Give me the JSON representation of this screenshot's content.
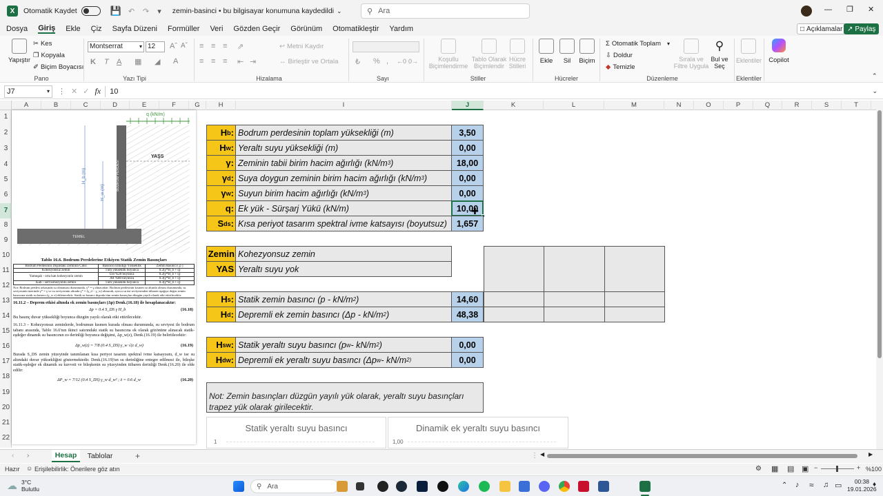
{
  "titlebar": {
    "autosave_label": "Otomatik Kaydet",
    "file_title": "zemin-basinci • bu bilgisayar konumuna kaydedildi",
    "search_placeholder": "Ara"
  },
  "menu": {
    "items": [
      "Dosya",
      "Giriş",
      "Ekle",
      "Çiz",
      "Sayfa Düzeni",
      "Formüller",
      "Veri",
      "Gözden Geçir",
      "Görünüm",
      "Otomatikleştir",
      "Yardım"
    ],
    "active": "Giriş",
    "comments": "Açıklamalar",
    "share": "Paylaş"
  },
  "ribbon": {
    "clipboard": {
      "paste": "Yapıştır",
      "cut": "Kes",
      "copy": "Kopyala",
      "format_painter": "Biçim Boyacısı",
      "group": "Pano"
    },
    "font": {
      "name": "Montserrat",
      "size": "12",
      "group": "Yazı Tipi"
    },
    "alignment": {
      "wrap": "Metni Kaydır",
      "merge": "Birleştir ve Ortala",
      "group": "Hizalama"
    },
    "number": {
      "group": "Sayı"
    },
    "styles": {
      "conditional": "Koşullu Biçimlendirme",
      "table": "Tablo Olarak Biçimlendir",
      "cell": "Hücre Stilleri",
      "group": "Stiller"
    },
    "cells": {
      "insert": "Ekle",
      "delete": "Sil",
      "format": "Biçim",
      "group": "Hücreler"
    },
    "editing": {
      "autosum": "Otomatik Toplam",
      "fill": "Doldur",
      "clear": "Temizle",
      "sort": "Sırala ve Filtre Uygula",
      "find": "Bul ve Seç",
      "group": "Düzenleme"
    },
    "addins": {
      "label": "Eklentiler",
      "group": "Eklentiler"
    },
    "copilot": {
      "label": "Copilot"
    }
  },
  "formula_bar": {
    "cell": "J7",
    "fx": "fx",
    "value": "10"
  },
  "columns": [
    "A",
    "B",
    "C",
    "D",
    "E",
    "F",
    "G",
    "H",
    "I",
    "J",
    "K",
    "L",
    "M",
    "N",
    "O",
    "P",
    "Q",
    "R",
    "S",
    "T"
  ],
  "selected_column": "J",
  "rows": [
    "1",
    "2",
    "3",
    "4",
    "5",
    "6",
    "7",
    "8",
    "9",
    "10",
    "11",
    "12",
    "13",
    "14",
    "15",
    "16",
    "17",
    "18",
    "19",
    "20",
    "21",
    "22"
  ],
  "selected_row": "7",
  "inputs": [
    {
      "sym": "H",
      "sub": "b",
      "desc": "Bodrum perdesinin toplam yüksekliği (m)",
      "sup": "",
      "tail": "",
      "value": "3,50"
    },
    {
      "sym": "H",
      "sub": "w",
      "desc": "Yeraltı suyu yüksekliği (m)",
      "sup": "",
      "tail": "",
      "value": "0,00"
    },
    {
      "sym": "γ",
      "sub": "",
      "desc": "Zeminin tabii birim hacim ağırlığı (kN/m",
      "sup": "3",
      "tail": " )",
      "value": "18,00"
    },
    {
      "sym": "γ",
      "sub": "d",
      "desc": "Suya doygun zeminin birim hacim ağırlığı (kN/m",
      "sup": "3",
      "tail": " )",
      "value": "0,00"
    },
    {
      "sym": "γ",
      "sub": "w",
      "desc": "Suyun birim hacim ağırlığı (kN/m",
      "sup": "3",
      "tail": " )",
      "value": "0,00"
    },
    {
      "sym": "q",
      "sub": "",
      "desc": "Ek yük - Sürşarj Yükü (kN/m)",
      "sup": "",
      "tail": "",
      "value": "10,00"
    },
    {
      "sym": "S",
      "sub": "ds",
      "desc": "Kısa periyot tasarım spektral ivme katsayısı (boyutsuz)",
      "sup": "",
      "tail": "",
      "value": "1,657"
    }
  ],
  "soil": [
    {
      "label": "Zemin",
      "value": "Kohezyonsuz zemin"
    },
    {
      "label": "YAS",
      "value": "Yeraltı suyu yok"
    }
  ],
  "results": [
    {
      "sym": "H",
      "sub": "s",
      "desc": "Statik zemin basıncı (p - kN/m",
      "sup": "2",
      "tail": " )",
      "value": "14,60"
    },
    {
      "sym": "H",
      "sub": "d",
      "desc": "Depremli ek zemin basıncı (Δp - kN/m",
      "sup": "2",
      "tail": " )",
      "value": "48,38"
    },
    {
      "sym": "H",
      "sub": "sw",
      "desc": "Statik yeraltı suyu basıncı (p",
      "descsub": "w",
      "desc2": " - kN/m",
      "sup": "2",
      "tail": " )",
      "value": "0,00"
    },
    {
      "sym": "H",
      "sub": "dw",
      "desc": "Depremli ek yeraltı suyu basıncı (Δp",
      "descsub": "w",
      "desc2": " - kN/m",
      "sup": "2)",
      "tail": "",
      "value": "0,00"
    }
  ],
  "note": {
    "line1": "Not: Zemin basınçları düzgün yayılı yük olarak, yeraltı suyu basınçları",
    "line2": "trapez yük olarak girilecektir."
  },
  "charts": [
    {
      "title": "Statik yeraltı suyu basıncı",
      "tick": "1"
    },
    {
      "title": "Dinamik ek yeraltı suyu basıncı",
      "tick": "1,00"
    }
  ],
  "figure": {
    "q_label": "q (kN/m)",
    "yas": "YAŞS",
    "hb": "H_b (m)",
    "hw": "H_w (m)",
    "wall": "BODRUM PERDESİ",
    "base": "TEMEL"
  },
  "doc": {
    "table_title": "Tablo 16.6. Bodrum Perdelerine Etkiyen Statik Zemin Basınçları",
    "col1": "Bodrum Perdesinin Dışındaki Zeminin Cinsi",
    "col2": "Basıncın Etkidiği Yükseklik",
    "col3": "Zemin Basıncı ( p )",
    "r1a": "Kohezyonsuz zemin",
    "r1b": "Tüm yükseklik boyunca",
    "r1c": "0.2(γ*H_b + q)",
    "r2a": "Yumuşak - orta katı kohezyonlu zemin",
    "r2b": "Üst %20 boyunca",
    "r2c": "0.2(γ*H_b + q)",
    "r2b2": "Alt %80 boyunca",
    "r2c2": "0.3(γ*H_b + q)",
    "r3a": "Katı - sert kohezyonlu zemin",
    "r3b": "Tüm yükseklik boyunca",
    "r3c": "0.3(γ*H_b + q)",
    "note": "Not: Bodrum perdesi arkasında su olmaması durumunda, γ* = γ alınacaktır. Bodrum perdesinin kısmen su altında olması durumunda, su seviyesinin üzerinde γ* = γ ve su seviyesinin altında γ* = (γ_d − γ_w) alınacak, ayrıca su üst seviyesinden itibaren aşağıya doğru zemin basıncına statik su basıncı (γ_w z) eklenecektir. Statik su basıncı dışında tüm zemin basınçları düzgün yayılı olarak etki ettirilecektir.",
    "p1": "16.11.2 – Deprem etkisi altında ek zemin basınçları (Δp) Denk.(16.18) ile hesaplanacaktır:",
    "eq1": "Δp = 0.4 S_DS γ H_b",
    "eq1n": "(16.18)",
    "p2": "Bu basınç duvar yüksekliği boyunca düzgün yayılı olarak etki ettirilecektir.",
    "p3": "16.11.3 – Kohezyonsuz zeminlerde, bodrumun kısmen kurada olması durumunda, su seviyesi ile bodrum tabanı arasında, Tablo 16.6'nın ikinci satırındaki statik su basıncına ek olarak gözönüne alınacak statik-eşdeğer dinamik su basıncının zo derinliği boyunca değişimi, Δp_w(z), Denk.(16.19) ile belirtilecektir:",
    "eq2": "Δp_w(z) = 7/8 (0.4 S_DS) γ_w √(z d_w)",
    "eq2n": "(16.19)",
    "p4": "Burada S_DS zemin yüzeyinde tanımlanan kısa periyot tasarım spektral ivme katsayısını, d_w ise su altındaki duvar yüksekliğini göstermektedir. Denk.(16.19)'un su derinliğine entegre edilmesi ile, bileşke statik-eşdeğer ek dinamik su kuvveti ve bileşkenin su yüzeyinden itibaren derinliği Denk.(16.20) ile elde edilir:",
    "eq3": "ΔP_w = 7/12 (0.4 S_DS) γ_w d_w²   ;   z̄ = 0.6 d_w",
    "eq3n": "(16.20)"
  },
  "sheets": [
    "Hesap",
    "Tablolar"
  ],
  "active_sheet": "Hesap",
  "status": {
    "ready": "Hazır",
    "accessibility": "Erişilebilirlik: Önerilere göz atın",
    "zoom": "%100"
  },
  "taskbar": {
    "weather_temp": "3°C",
    "weather_desc": "Bulutlu",
    "search": "Ara",
    "time": "00:38",
    "date": "19.01.2026"
  }
}
